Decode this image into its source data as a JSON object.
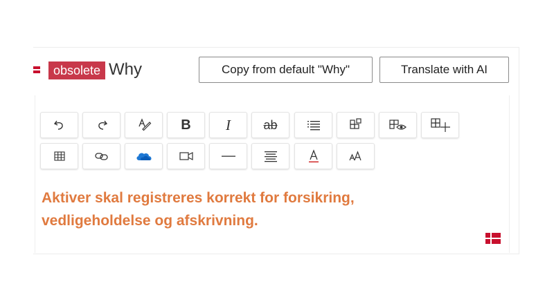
{
  "header": {
    "badge_label": "obsolete",
    "title": "Why",
    "copy_button_label": "Copy from default \"Why\"",
    "translate_button_label": "Translate with AI"
  },
  "toolbar": {
    "bold_glyph": "B",
    "italic_glyph": "I",
    "strikethrough_glyph": "ab"
  },
  "editor": {
    "lines": [
      "Aktiver skal registreres korrekt for forsikring,",
      "vedligeholdelse og afskrivning."
    ]
  },
  "colors": {
    "badge": "#c8384a",
    "content_text": "#e07a3f",
    "flag": "#c8102e",
    "onedrive": "#1e78d4"
  },
  "icons": [
    "undo-icon",
    "redo-icon",
    "spellcheck-icon",
    "bold-icon",
    "italic-icon",
    "strikethrough-icon",
    "bullet-list-icon",
    "insert-block-icon",
    "preview-block-icon",
    "add-block-icon",
    "table-icon",
    "link-icon",
    "onedrive-icon",
    "video-icon",
    "horizontal-rule-icon",
    "align-icon",
    "font-color-icon",
    "font-size-icon",
    "danish-flag-icon"
  ]
}
